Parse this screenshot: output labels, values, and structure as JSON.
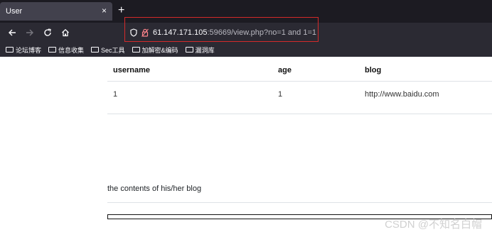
{
  "browser": {
    "tab_title": "User",
    "tab_close": "×",
    "new_tab": "+",
    "url_host": "61.147.171.105",
    "url_rest": ":59669/view.php?no=1 and 1=1"
  },
  "bookmarks": [
    {
      "label": "论坛博客"
    },
    {
      "label": "信息收集"
    },
    {
      "label": "Sec工具"
    },
    {
      "label": "加解密&编码"
    },
    {
      "label": "漏洞库"
    }
  ],
  "table": {
    "headers": [
      "username",
      "age",
      "blog"
    ],
    "rows": [
      [
        "1",
        "1",
        "http://www.baidu.com"
      ]
    ]
  },
  "blog_heading": "the contents of his/her blog",
  "watermark": "CSDN @不知名白帽",
  "colors": {
    "tab_bg": "#42414d",
    "toolbar_bg": "#2b2a33",
    "highlight_border": "#d42a2a"
  }
}
